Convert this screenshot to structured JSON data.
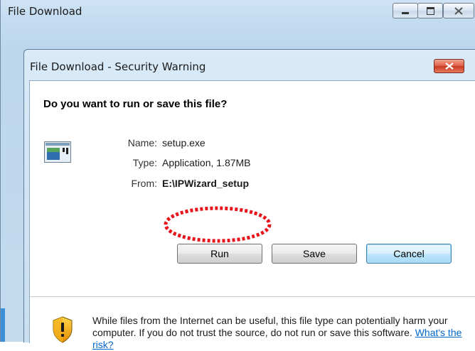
{
  "outer_window": {
    "title": "File Download",
    "controls": [
      "minimize",
      "maximize",
      "close"
    ]
  },
  "dialog": {
    "title": "File Download - Security Warning",
    "question": "Do you want to run or save this file?",
    "fields": [
      {
        "label": "Name:",
        "value": "setup.exe",
        "bold": false
      },
      {
        "label": "Type:",
        "value": "Application, 1.87MB",
        "bold": false
      },
      {
        "label": "From:",
        "value": "E:\\IPWizard_setup",
        "bold": true
      }
    ],
    "buttons": {
      "run": "Run",
      "save": "Save",
      "cancel": "Cancel"
    },
    "warning": {
      "text": "While files from the Internet can be useful, this file type can potentially harm your computer. If you do not trust the source, do not run or save this software. ",
      "link": "What's the risk?"
    }
  },
  "colors": {
    "highlight": "#e8141b",
    "link": "#0066cc",
    "close_button": "#c83a22"
  },
  "icons": {
    "file": "application-file-icon",
    "shield": "security-shield-icon"
  }
}
